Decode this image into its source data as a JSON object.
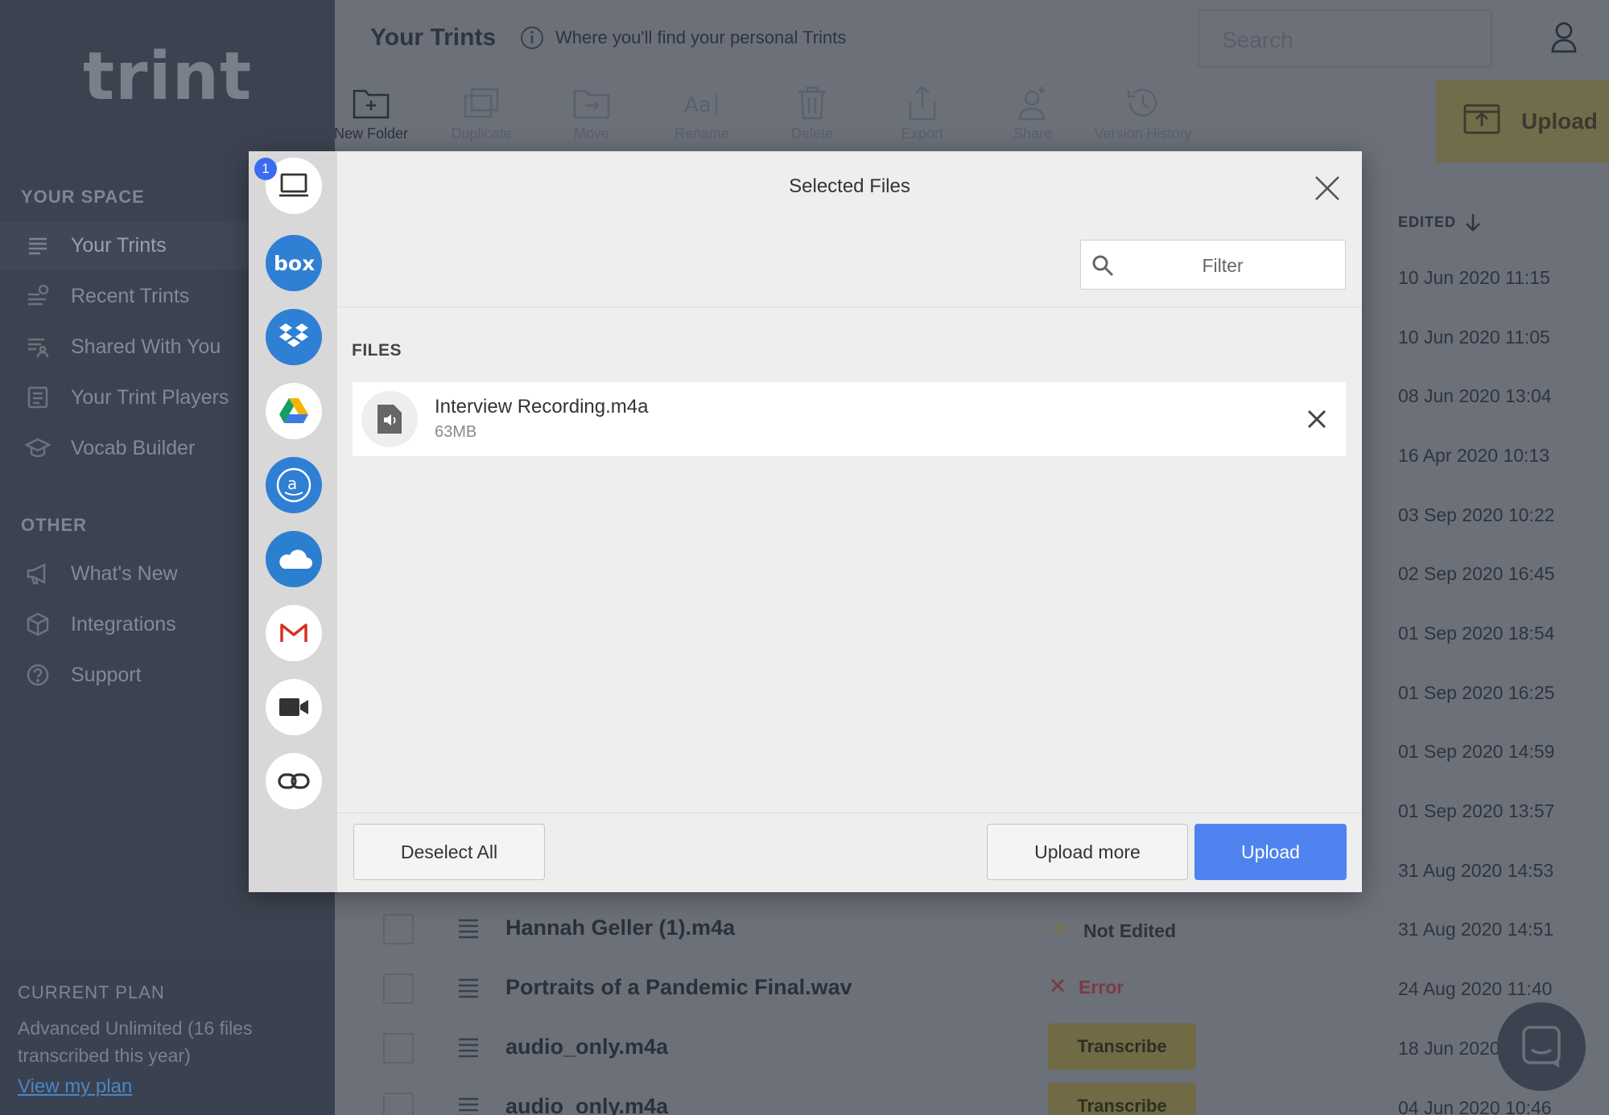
{
  "app": {
    "logo": "trint"
  },
  "sidebar": {
    "your_space_title": "YOUR SPACE",
    "items": [
      {
        "label": "Your Trints",
        "icon": "list-icon"
      },
      {
        "label": "Recent Trints",
        "icon": "recent-icon"
      },
      {
        "label": "Shared With You",
        "icon": "shared-icon"
      },
      {
        "label": "Your Trint Players",
        "icon": "player-icon"
      },
      {
        "label": "Vocab Builder",
        "icon": "graduation-cap-icon"
      }
    ],
    "other_title": "OTHER",
    "other_items": [
      {
        "label": "What's New",
        "icon": "megaphone-icon"
      },
      {
        "label": "Integrations",
        "icon": "cubes-icon"
      },
      {
        "label": "Support",
        "icon": "help-icon"
      }
    ],
    "plan": {
      "title": "CURRENT PLAN",
      "description": "Advanced Unlimited (16 files transcribed this year)",
      "link": "View my plan"
    }
  },
  "header": {
    "title": "Your Trints",
    "subtitle": "Where you'll find your personal Trints",
    "search_placeholder": "Search"
  },
  "toolbar": {
    "items": [
      "New Folder",
      "Duplicate",
      "Move",
      "Rename",
      "Delete",
      "Export",
      "Share",
      "Version History"
    ],
    "upload_label": "Upload"
  },
  "list": {
    "edited_header": "EDITED",
    "dates": [
      "10 Jun 2020 11:15",
      "10 Jun 2020 11:05",
      "08 Jun 2020 13:04",
      "16 Apr 2020 10:13",
      "03 Sep 2020 10:22",
      "02 Sep 2020 16:45",
      "01 Sep 2020 18:54",
      "01 Sep 2020 16:25",
      "01 Sep 2020 14:59",
      "01 Sep 2020 13:57",
      "31 Aug 2020 14:53"
    ],
    "rows": [
      {
        "name": "Hannah Geller (1).m4a",
        "status": "Not Edited",
        "date": "31 Aug 2020 14:51"
      },
      {
        "name": "Portraits of a Pandemic Final.wav",
        "status": "Error",
        "date": "24 Aug 2020 11:40"
      },
      {
        "name": "audio_only.m4a",
        "action": "Transcribe",
        "date": "18 Jun 2020"
      },
      {
        "name": "audio_only.m4a",
        "action": "Transcribe",
        "date": "04 Jun 2020 10:46"
      }
    ]
  },
  "modal": {
    "title": "Selected Files",
    "badge_count": "1",
    "sources": [
      "computer-icon",
      "box-icon",
      "dropbox-icon",
      "google-drive-icon",
      "amazon-drive-icon",
      "onedrive-icon",
      "gmail-icon",
      "video-icon",
      "link-icon"
    ],
    "filter_placeholder": "Filter",
    "files_header": "FILES",
    "file": {
      "name": "Interview Recording.m4a",
      "size": "63MB"
    },
    "deselect_label": "Deselect All",
    "upload_more_label": "Upload more",
    "upload_label": "Upload"
  },
  "colors": {
    "primary": "#4f83ef",
    "sidebar_bg": "#3c4350",
    "overlay_bg": "#6b7079",
    "modal_bg": "#eeeeee",
    "badge": "#3b6cf0"
  }
}
